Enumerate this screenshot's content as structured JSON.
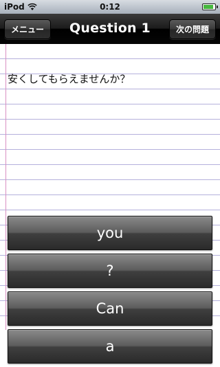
{
  "status_bar": {
    "carrier": "iPod",
    "time": "0:12",
    "wifi_icon": "wifi-icon",
    "battery_icon": "battery-icon",
    "battery_level": 0.9,
    "battery_color": "#46b83f"
  },
  "nav": {
    "title": "Question 1",
    "menu_label": "メニュー",
    "next_label": "次の問題"
  },
  "question": {
    "text": "安くしてもらえませんか？"
  },
  "answers": [
    {
      "label": "you"
    },
    {
      "label": "?"
    },
    {
      "label": "Can"
    },
    {
      "label": "a"
    }
  ]
}
